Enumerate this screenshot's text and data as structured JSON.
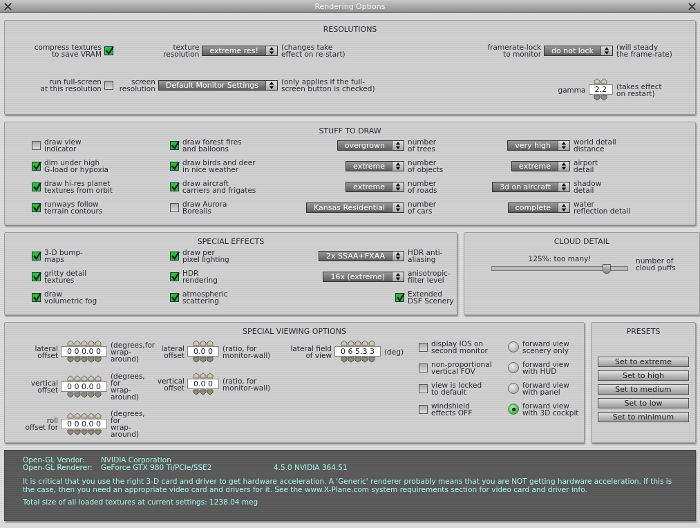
{
  "window": {
    "title": "Rendering Options"
  },
  "panels": [
    {
      "title": "RESOLUTIONS",
      "columns": [
        [
          {
            "kind": "check",
            "label": "compress textures\nto save VRAM",
            "checked": true
          },
          {
            "kind": "check",
            "label": "run full-screen\nat this resolution",
            "checked": false
          }
        ],
        [
          {
            "kind": "select",
            "label": "texture\nresolution",
            "value": "extreme res!",
            "note": "(changes take\neffect on re-start)"
          },
          {
            "kind": "select",
            "label": "screen\nresolution",
            "value": "Default Monitor Settings",
            "note": "(only applies if the full-\nscreen button is checked)"
          }
        ],
        [
          {
            "kind": "select",
            "label": "framerate-lock\nto monitor",
            "value": "do not lock",
            "note": "(will steady\nthe frame-rate)"
          },
          {
            "kind": "spinner",
            "label": "gamma",
            "value": "2.2",
            "note": "(takes effect\non restart)"
          }
        ]
      ]
    },
    {
      "title": "STUFF TO DRAW",
      "columns": [
        [
          {
            "kind": "check",
            "note": "draw view\nindicator",
            "checked": false
          },
          {
            "kind": "check",
            "note": "dim under high\nG-load or hypoxia",
            "checked": true
          },
          {
            "kind": "check",
            "note": "draw hi-res planet\ntextures from orbit",
            "checked": true
          },
          {
            "kind": "check",
            "note": "runways follow\nterrain contours",
            "checked": true
          }
        ],
        [
          {
            "kind": "check",
            "note": "draw forest fires\nand balloons",
            "checked": true
          },
          {
            "kind": "check",
            "note": "draw birds and deer\nin nice weather",
            "checked": true
          },
          {
            "kind": "check",
            "note": "draw aircraft\ncarriers and frigates",
            "checked": true
          },
          {
            "kind": "check",
            "note": "draw Aurora\nBorealis",
            "checked": false
          }
        ],
        [
          {
            "kind": "select",
            "value": "overgrown",
            "note": "number\nof trees"
          },
          {
            "kind": "select",
            "value": "extreme",
            "note": "number\nof objects"
          },
          {
            "kind": "select",
            "value": "extreme",
            "note": "number\nof roads"
          },
          {
            "kind": "select",
            "value": "Kansas Residential",
            "note": "number\nof cars"
          }
        ],
        [
          {
            "kind": "select",
            "value": "very high",
            "note": "world detail\ndistance"
          },
          {
            "kind": "select",
            "value": "extreme",
            "note": "airport\ndetail"
          },
          {
            "kind": "select",
            "value": "3d on aircraft",
            "note": "shadow\ndetail"
          },
          {
            "kind": "select",
            "value": "complete",
            "note": "water\nreflection detail"
          }
        ]
      ]
    },
    {
      "title": "SPECIAL EFFECTS",
      "columns": [
        [
          {
            "kind": "check",
            "note": "3-D bump-\nmaps",
            "checked": true
          },
          {
            "kind": "check",
            "note": "gritty detail\ntextures",
            "checked": true
          },
          {
            "kind": "check",
            "note": "draw\nvolumetric fog",
            "checked": true
          }
        ],
        [
          {
            "kind": "check",
            "note": "draw per\npixel lighting",
            "checked": true
          },
          {
            "kind": "check",
            "note": "HDR\nrendering",
            "checked": true
          },
          {
            "kind": "check",
            "note": "atmospheric\nscattering",
            "checked": true
          }
        ],
        [
          {
            "kind": "select",
            "value": "2x SSAA+FXAA",
            "note": "HDR anti-\naliasing"
          },
          {
            "kind": "select",
            "value": "16x (extreme)",
            "note": "anisotropic-\nfilter level"
          },
          {
            "kind": "check",
            "note": "Extended\nDSF Scenery",
            "checked": true
          }
        ]
      ]
    },
    {
      "title": "CLOUD DETAIL",
      "columns": [
        [
          {
            "kind": "slider",
            "caption": "125%: too many!",
            "level": 0.84,
            "note": "number of\ncloud puffs"
          }
        ]
      ]
    },
    {
      "title": "SPECIAL VIEWING OPTIONS",
      "columns": [
        [
          {
            "kind": "spinner",
            "label": "lateral\noffset",
            "value": "0 0 0.0 0",
            "note": "(degrees,for\nwrap-around)"
          },
          {
            "kind": "spinner",
            "label": "vertical\noffset",
            "value": "0 0 0.0 0",
            "note": "(degrees, for\nwrap-around)"
          },
          {
            "kind": "spinner",
            "label": "roll\noffset for",
            "value": "0 0 0.0 0",
            "note": "(degrees, for\nwrap-around)"
          }
        ],
        [
          {
            "kind": "spinner",
            "label": "lateral\noffset",
            "value": "0.0 0",
            "note": "(ratio, for\nmonitor-wall)"
          },
          {
            "kind": "spinner",
            "label": "vertical\noffset",
            "value": "0.0 0",
            "note": "(ratio, for\nmonitor-wall)"
          }
        ],
        [
          {
            "kind": "spinner",
            "label": "lateral field\nof view",
            "value": "0 6 5.3 3",
            "note": "(deg)"
          }
        ],
        [
          {
            "kind": "check",
            "note": "display IOS on\nsecond monitor",
            "checked": false
          },
          {
            "kind": "check",
            "note": "non-proportional\nvertical FOV",
            "checked": false
          },
          {
            "kind": "check",
            "note": "view is locked\nto default",
            "checked": false
          },
          {
            "kind": "check",
            "note": "windshield\neffects OFF",
            "checked": false
          }
        ],
        [
          {
            "kind": "radio",
            "note": "forward view\nscenery only",
            "selected": false
          },
          {
            "kind": "radio",
            "note": "forward view\nwith HUD",
            "selected": false
          },
          {
            "kind": "radio",
            "note": "forward view\nwith panel",
            "selected": false
          },
          {
            "kind": "radio",
            "note": "forward view\nwith 3D cockpit",
            "selected": true
          }
        ]
      ]
    },
    {
      "title": "PRESETS",
      "columns": [
        [
          {
            "kind": "button",
            "label": "Set to extreme"
          },
          {
            "kind": "button",
            "label": "Set to high"
          },
          {
            "kind": "button",
            "label": "Set to medium"
          },
          {
            "kind": "button",
            "label": "Set to low"
          },
          {
            "kind": "button",
            "label": "Set to minimum"
          }
        ]
      ]
    }
  ],
  "info": {
    "vendor_label": "Open-GL Vendor:",
    "vendor": "NVIDIA Corporation",
    "renderer_label": "Open-GL Renderer:",
    "renderer": "GeForce GTX 980 Ti/PCIe/SSE2",
    "version": "4.5.0 NVIDIA 364.51",
    "warning": "It is critical that you use the right 3-D card and driver to get hardware acceleration. A 'Generic' renderer probably means that you are NOT getting hardware acceleration. If this is\nthe case, then you need an appropriate video card and drivers for it. See the www.X-Plane.com system requirements section for video card and driver info.",
    "texture_size": "Total size of all loaded textures at current settings: 1238.04 meg"
  }
}
